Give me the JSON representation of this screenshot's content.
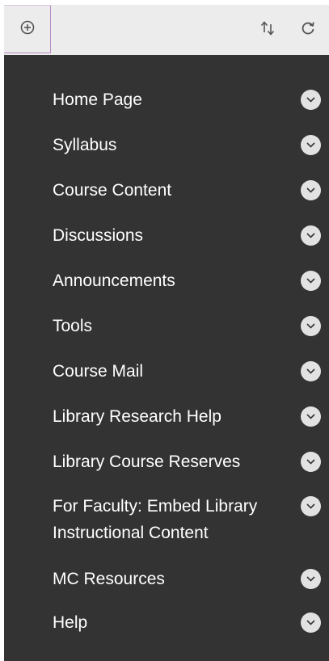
{
  "toolbar": {
    "add_icon": "add-circle-icon",
    "reorder_icon": "reorder-arrows-icon",
    "refresh_icon": "refresh-icon"
  },
  "menu": {
    "items": [
      {
        "label": "Home Page"
      },
      {
        "label": "Syllabus"
      },
      {
        "label": "Course Content"
      },
      {
        "label": "Discussions"
      },
      {
        "label": "Announcements"
      },
      {
        "label": "Tools"
      },
      {
        "label": "Course Mail"
      },
      {
        "label": "Library Research Help"
      },
      {
        "label": "Library Course Reserves"
      },
      {
        "label": "For Faculty: Embed Library Instructional Content"
      },
      {
        "label": "MC Resources"
      },
      {
        "label": "Help"
      }
    ]
  },
  "colors": {
    "panel_background": "#333333",
    "toolbar_background": "#ececec",
    "focus_border": "#b98cc6",
    "item_text": "#ffffff",
    "chevron_badge": "#e2e2e2"
  }
}
